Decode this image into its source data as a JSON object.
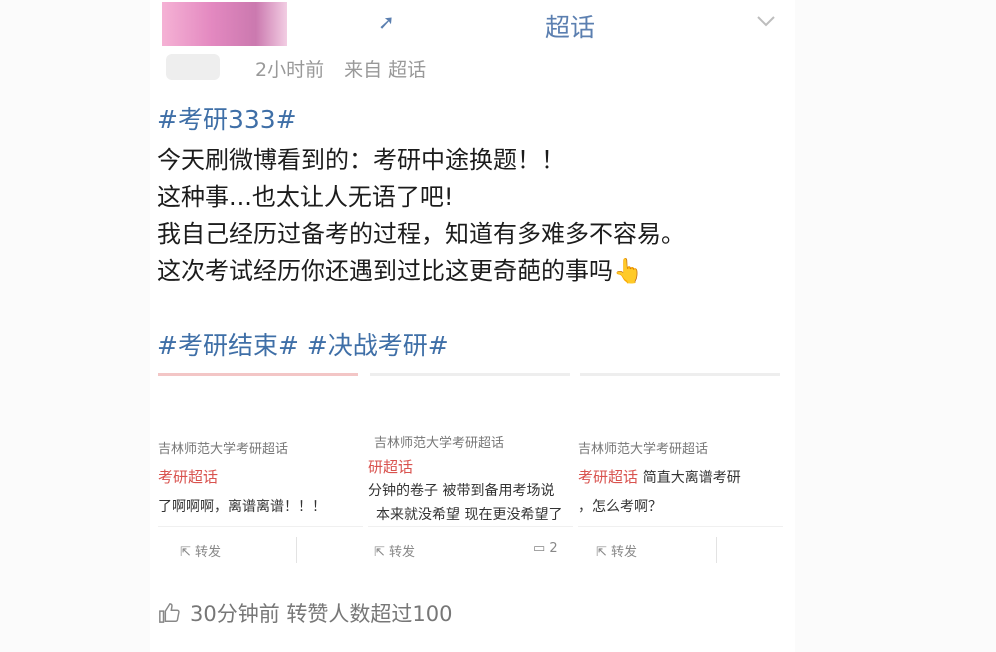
{
  "topic": {
    "name": "超话",
    "icon": "link-icon"
  },
  "meta": {
    "time": "2小时前",
    "source": "来自 超话"
  },
  "post": {
    "hashtag": "#考研333#",
    "lines": [
      "今天刷微博看到的：考研中途换题！！",
      "这种事...也太让人无语了吧!",
      "我自己经历过备考的过程，知道有多难多不容易。",
      "这次考试经历你还遇到过比这更奇葩的事吗"
    ],
    "emoji": "👆",
    "tags": [
      "#考研结束#",
      "#决战考研#"
    ]
  },
  "tiles": [
    {
      "source": "吉林师范大学考研超话",
      "topic": "考研超话",
      "text": "了啊啊啊，离谱离谱！！！",
      "text2": "",
      "forward": "转发",
      "count": ""
    },
    {
      "source": "吉林师范大学考研超话",
      "topic": "研超话",
      "text": "分钟的卷子 被带到备用考场说",
      "text2": "本来就没希望 现在更没希望了",
      "forward": "转发",
      "count": "2"
    },
    {
      "source": "吉林师范大学考研超话",
      "topic": "考研超话",
      "text": "简直大离谱考研",
      "text2": "，怎么考啊？",
      "forward": "转发",
      "count": ""
    }
  ],
  "footer": {
    "likes_text": "30分钟前 转赞人数超过100"
  },
  "colors": {
    "link": "#3f6fa7",
    "topic_red": "#d9534f",
    "meta_gray": "#999999"
  }
}
